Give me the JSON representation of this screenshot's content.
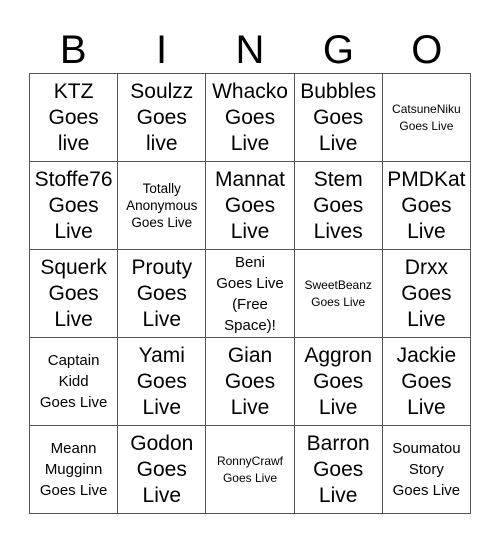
{
  "header": {
    "letters": [
      "B",
      "I",
      "N",
      "G",
      "O"
    ]
  },
  "cells": [
    {
      "text": "KTZ\nGoes\nlive",
      "size": "big"
    },
    {
      "text": "Soulzz\nGoes\nlive",
      "size": "big"
    },
    {
      "text": "Whacko\nGoes\nLive",
      "size": "big"
    },
    {
      "text": "Bubbles\nGoes\nLive",
      "size": "big"
    },
    {
      "text": "CatsuneNiku\nGoes Live",
      "size": "xs"
    },
    {
      "text": "Stoffe76\nGoes\nLive",
      "size": "big"
    },
    {
      "text": "Totally\nAnonymous\nGoes Live",
      "size": "sm"
    },
    {
      "text": "Mannat\nGoes\nLive",
      "size": "big"
    },
    {
      "text": "Stem\nGoes\nLives",
      "size": "big"
    },
    {
      "text": "PMDKat\nGoes\nLive",
      "size": "big"
    },
    {
      "text": "Squerk\nGoes\nLive",
      "size": "big"
    },
    {
      "text": "Prouty\nGoes\nLive",
      "size": "big"
    },
    {
      "text": "Beni\nGoes Live\n(Free\nSpace)!",
      "size": "med"
    },
    {
      "text": "SweetBeanz\nGoes Live",
      "size": "xs"
    },
    {
      "text": "Drxx\nGoes\nLive",
      "size": "big"
    },
    {
      "text": "Captain\nKidd\nGoes Live",
      "size": "med"
    },
    {
      "text": "Yami\nGoes\nLive",
      "size": "big"
    },
    {
      "text": "Gian\nGoes\nLive",
      "size": "big"
    },
    {
      "text": "Aggron\nGoes\nLive",
      "size": "big"
    },
    {
      "text": "Jackie\nGoes\nLive",
      "size": "big"
    },
    {
      "text": "Meann\nMugginn\nGoes Live",
      "size": "med"
    },
    {
      "text": "Godon\nGoes\nLive",
      "size": "big"
    },
    {
      "text": "RonnyCrawf\nGoes Live",
      "size": "xs"
    },
    {
      "text": "Barron\nGoes\nLive",
      "size": "big"
    },
    {
      "text": "Soumatou\nStory\nGoes Live",
      "size": "med"
    }
  ]
}
